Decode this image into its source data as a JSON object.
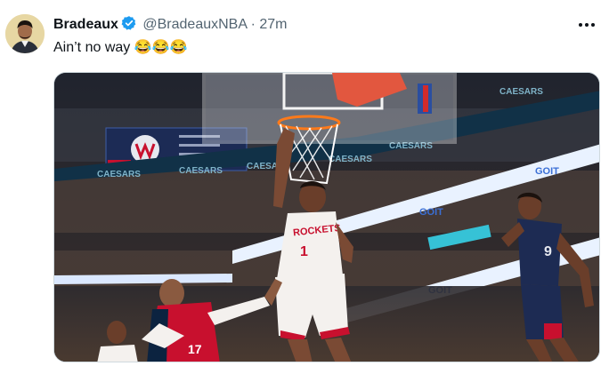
{
  "tweet": {
    "author_name": "Bradeaux",
    "handle": "@BradeauxNBA",
    "separator": "·",
    "time": "27m",
    "text": "Ain’t no way",
    "emojis": "😂😂😂",
    "verified_icon": "verified-badge-icon",
    "more_icon": "more-options-icon",
    "verified_color": "#1d9bf0"
  },
  "media": {
    "jersey_team": "ROCKETS",
    "jersey_number": "1",
    "defender_number": "9",
    "player_number_left": "17",
    "sponsor_board": "CAESARS",
    "ad_board": "GOIT"
  }
}
